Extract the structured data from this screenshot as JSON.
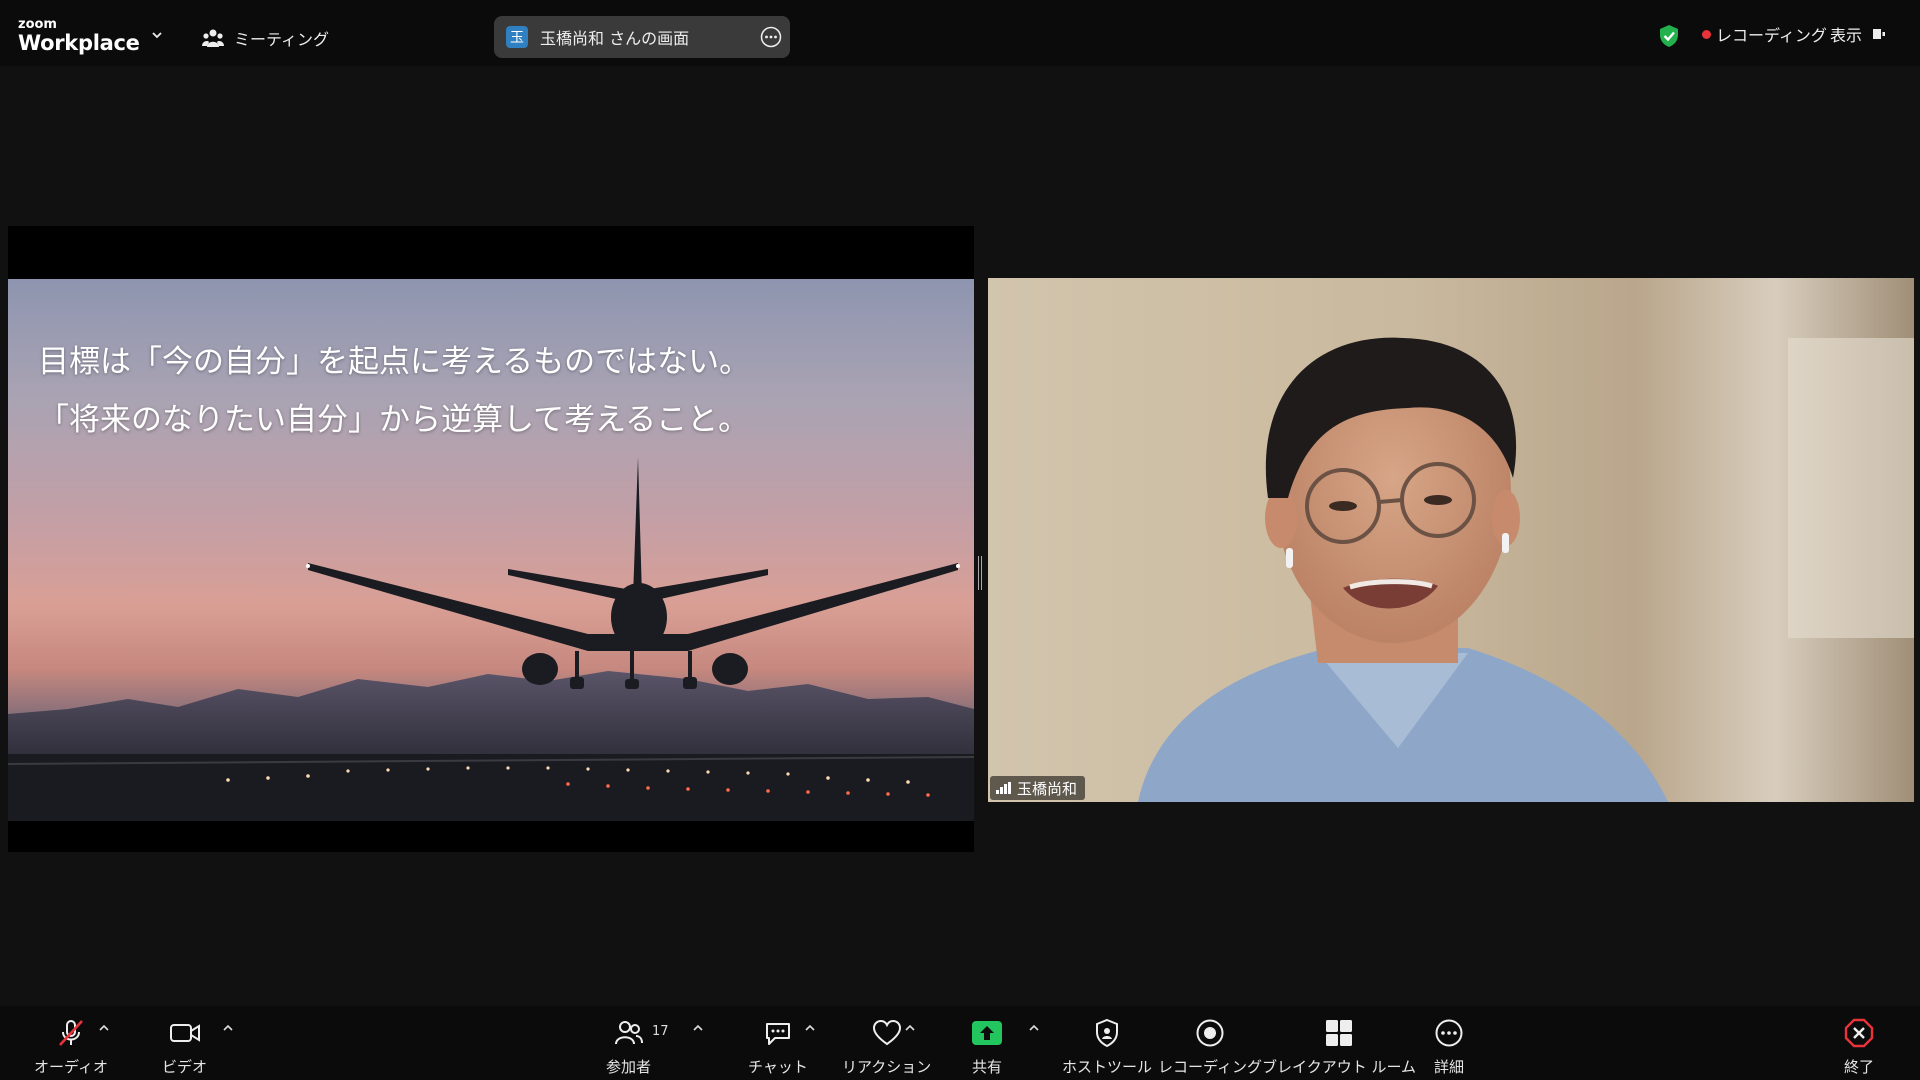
{
  "app": {
    "brand_small": "zoom",
    "brand_large": "Workplace"
  },
  "topbar": {
    "meeting_label": "ミーティング",
    "share_owner_initial": "玉",
    "share_label": "玉橋尚和 さんの画面",
    "recording_label": "レコーディング",
    "view_label": "表示"
  },
  "slide": {
    "line1": "目標は「今の自分」を起点に考えるものではない。",
    "line2": "「将来のなりたい自分」から逆算して考えること。"
  },
  "participant": {
    "name": "玉橋尚和"
  },
  "toolbar": {
    "audio": "オーディオ",
    "video": "ビデオ",
    "participants": "参加者",
    "participants_count": "17",
    "chat": "チャット",
    "reactions": "リアクション",
    "share": "共有",
    "host_tools": "ホストツール",
    "recording": "レコーディング",
    "breakout": "ブレイクアウト ルーム",
    "more": "詳細",
    "end": "終了"
  },
  "colors": {
    "share_green": "#22c55e",
    "end_red": "#e8333a",
    "shield_green": "#22b14c"
  }
}
